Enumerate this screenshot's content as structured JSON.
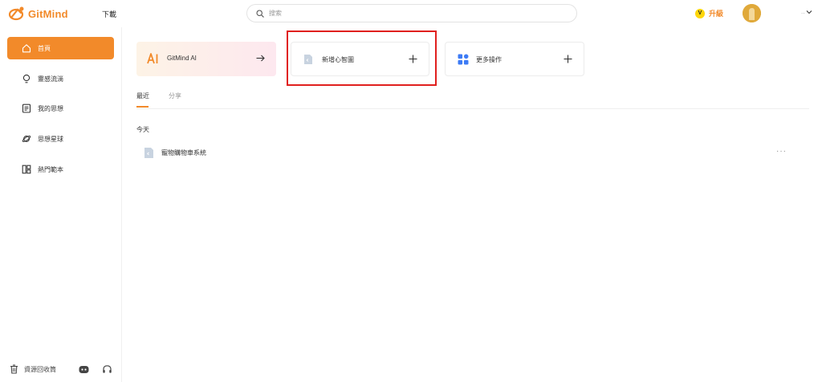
{
  "header": {
    "brand": "GitMind",
    "download_label": "下載",
    "search_placeholder": "搜索",
    "upgrade_badge": "V",
    "upgrade_label": "升級",
    "account_menu_dots": "..",
    "brand_color": "#f28a2a"
  },
  "sidebar": {
    "items": [
      {
        "label": "首頁",
        "icon": "home-icon",
        "active": true
      },
      {
        "label": "靈感流淌",
        "icon": "lightbulb-icon",
        "active": false
      },
      {
        "label": "我的思想",
        "icon": "document-icon",
        "active": false
      },
      {
        "label": "思想星球",
        "icon": "planet-icon",
        "active": false
      },
      {
        "label": "熱門範本",
        "icon": "template-icon",
        "active": false
      }
    ],
    "footer": {
      "trash_label": "資源回收筒",
      "icons": [
        "discord-icon",
        "headset-icon"
      ]
    }
  },
  "main": {
    "cards": {
      "ai": {
        "title": "GitMind AI",
        "icon": "ai-icon",
        "action": "arrow-right-icon"
      },
      "new_map": {
        "title": "新增心智圖",
        "icon": "mindmap-file-icon",
        "action": "plus-icon"
      },
      "more": {
        "title": "更多操作",
        "icon": "grid-icon",
        "action": "plus-icon"
      }
    },
    "tabs": [
      {
        "label": "最近",
        "active": true
      },
      {
        "label": "分享",
        "active": false
      }
    ],
    "section_title": "今天",
    "files": [
      {
        "name": "寵物購物車系統",
        "icon": "mindmap-file-icon",
        "menu": "···"
      }
    ]
  }
}
